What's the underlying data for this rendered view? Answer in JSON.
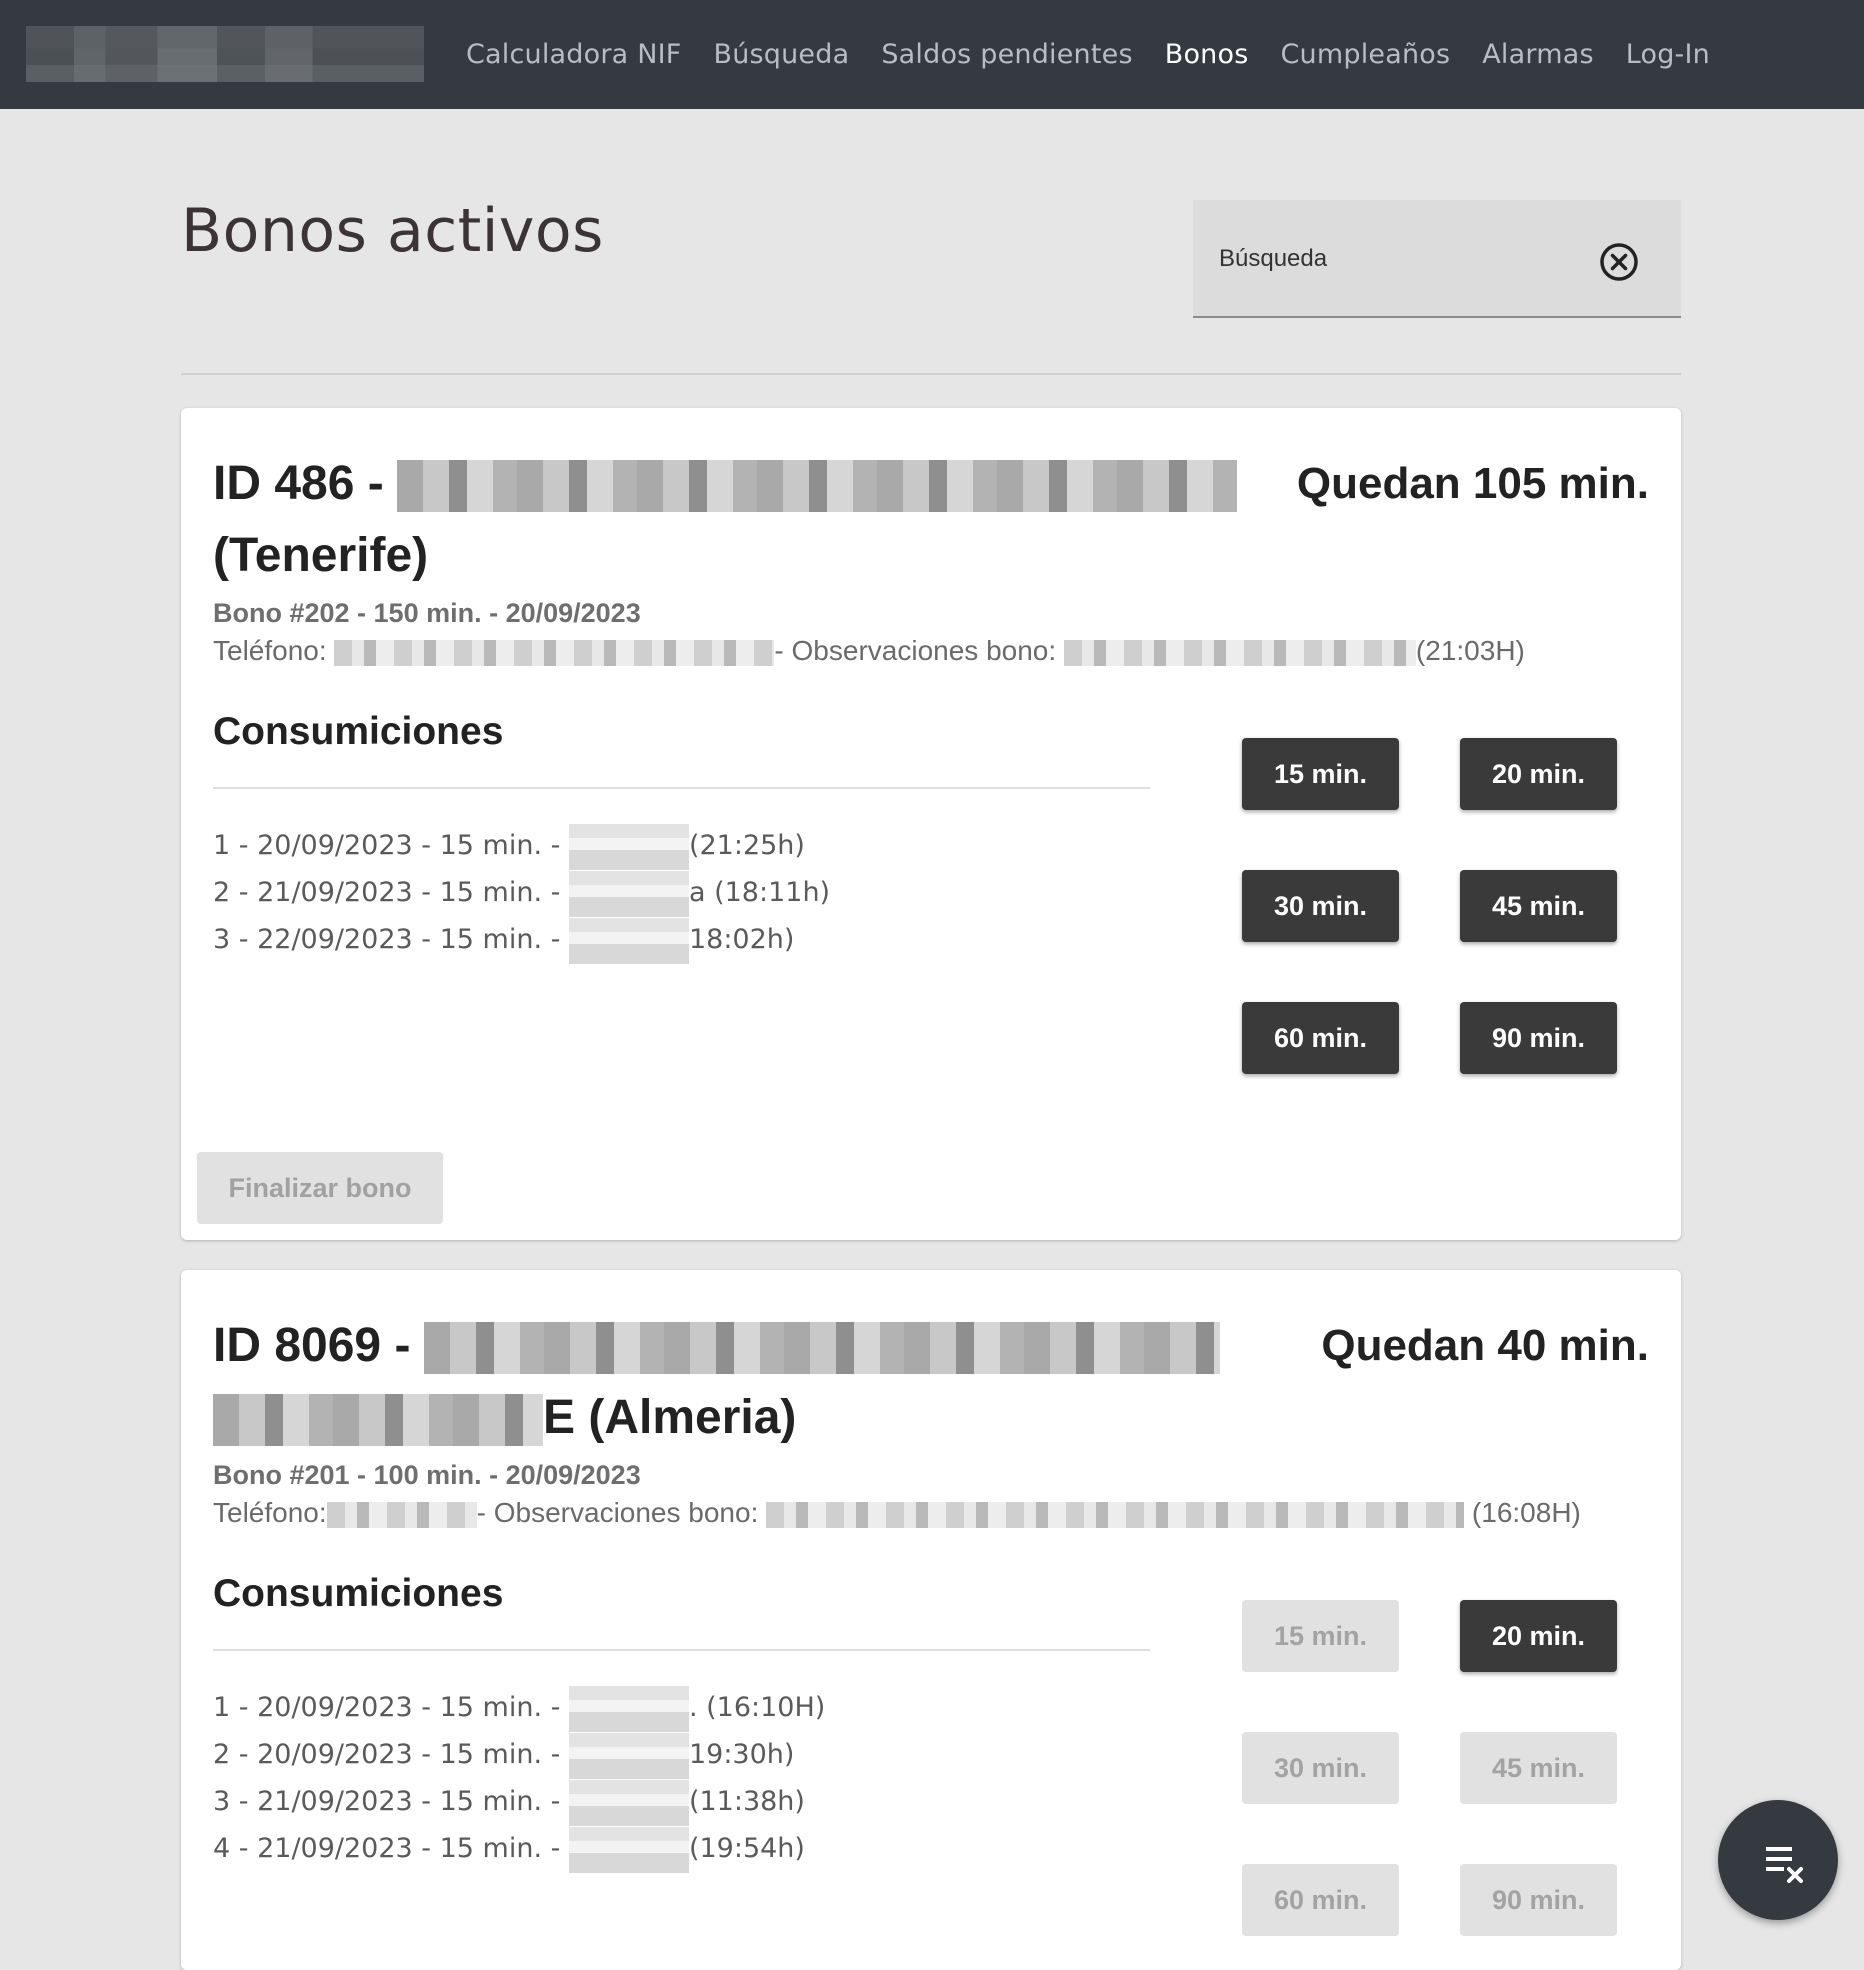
{
  "nav": {
    "logo_name": "logo-pixelated",
    "items": [
      {
        "label": "Calculadora NIF",
        "active": false
      },
      {
        "label": "Búsqueda",
        "active": false
      },
      {
        "label": "Saldos pendientes",
        "active": false
      },
      {
        "label": "Bonos",
        "active": true
      },
      {
        "label": "Cumpleaños",
        "active": false
      },
      {
        "label": "Alarmas",
        "active": false
      },
      {
        "label": "Log-In",
        "active": false
      }
    ]
  },
  "page": {
    "title": "Bonos activos",
    "search": {
      "placeholder": "Búsqueda",
      "value": "",
      "clear_icon": "close-circle-icon"
    }
  },
  "cards": [
    {
      "id_label": "ID 486 -",
      "location": "(Tenerife)",
      "remaining": "Quedan 105 min.",
      "bono": "Bono #202 - 150 min. - 20/09/2023",
      "phone_label": "Teléfono:",
      "obs_label": "- Observaciones bono:",
      "obs_time": "(21:03H)",
      "consumptions_heading": "Consumiciones",
      "consumptions": [
        {
          "prefix": "1 - 20/09/2023 - 15 min. -",
          "suffix": "(21:25h)"
        },
        {
          "prefix": "2 - 21/09/2023 - 15 min. -",
          "suffix": "a (18:11h)"
        },
        {
          "prefix": "3 - 22/09/2023 - 15 min. -",
          "suffix": "18:02h)"
        }
      ],
      "buttons": [
        {
          "label": "15 min.",
          "enabled": true
        },
        {
          "label": "20 min.",
          "enabled": true
        },
        {
          "label": "30 min.",
          "enabled": true
        },
        {
          "label": "45 min.",
          "enabled": true
        },
        {
          "label": "60 min.",
          "enabled": true
        },
        {
          "label": "90 min.",
          "enabled": true
        }
      ],
      "finish_label": "Finalizar bono"
    },
    {
      "id_label": "ID 8069 -",
      "location": "E (Almeria)",
      "remaining": "Quedan 40 min.",
      "bono": "Bono #201 - 100 min. - 20/09/2023",
      "phone_label": "Teléfono:",
      "obs_label": "- Observaciones bono:",
      "obs_time": "(16:08H)",
      "consumptions_heading": "Consumiciones",
      "consumptions": [
        {
          "prefix": "1 - 20/09/2023 - 15 min. -",
          "suffix": ". (16:10H)"
        },
        {
          "prefix": "2 - 20/09/2023 - 15 min. -",
          "suffix": "19:30h)"
        },
        {
          "prefix": "3 - 21/09/2023 - 15 min. -",
          "suffix": "(11:38h)"
        },
        {
          "prefix": "4 - 21/09/2023 - 15 min. -",
          "suffix": "(19:54h)"
        }
      ],
      "buttons": [
        {
          "label": "15 min.",
          "enabled": false
        },
        {
          "label": "20 min.",
          "enabled": true
        },
        {
          "label": "30 min.",
          "enabled": false
        },
        {
          "label": "45 min.",
          "enabled": false
        },
        {
          "label": "60 min.",
          "enabled": false
        },
        {
          "label": "90 min.",
          "enabled": false
        }
      ]
    }
  ],
  "fab": {
    "icon": "clear-list-icon"
  }
}
